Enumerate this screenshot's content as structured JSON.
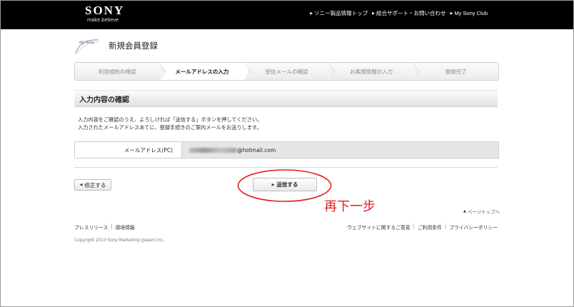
{
  "header": {
    "brand": "SONY",
    "tagline": "make.believe",
    "nav": [
      {
        "label": "ソニー製品情報トップ"
      },
      {
        "label": "総合サポート・お問い合わせ"
      },
      {
        "label": "My Sony Club"
      }
    ]
  },
  "page": {
    "mysony_logo_text": "My Sony",
    "title": "新規会員登録"
  },
  "steps": [
    {
      "label": "利用規約の確認",
      "active": false
    },
    {
      "label": "メールアドレスの入力",
      "active": true
    },
    {
      "label": "受信メールの確認",
      "active": false
    },
    {
      "label": "お客様情報の入力",
      "active": false
    },
    {
      "label": "登録完了",
      "active": false
    }
  ],
  "confirm": {
    "section_title": "入力内容の確認",
    "desc_line1": "入力内容をご確認のうえ、よろしければ「送信する」ボタンを押してください。",
    "desc_line2": "入力されたメールアドレスあてに、登録手続きのご案内メールをお送りします。",
    "email_label": "メールアドレス(PC)",
    "email_domain": "@hotmail.com"
  },
  "buttons": {
    "back": "修正する",
    "send": "送信する"
  },
  "annotation": {
    "text": "再下一步",
    "color": "#e02020"
  },
  "pagetop": "ページトップへ",
  "footer": {
    "left": [
      "プレスリリース",
      "環境情報"
    ],
    "right": [
      "ウェブサイトに関するご意見",
      "ご利用条件",
      "プライバシーポリシー"
    ],
    "copyright": "Copyright 2010 Sony Marketing (Japan) Inc."
  }
}
